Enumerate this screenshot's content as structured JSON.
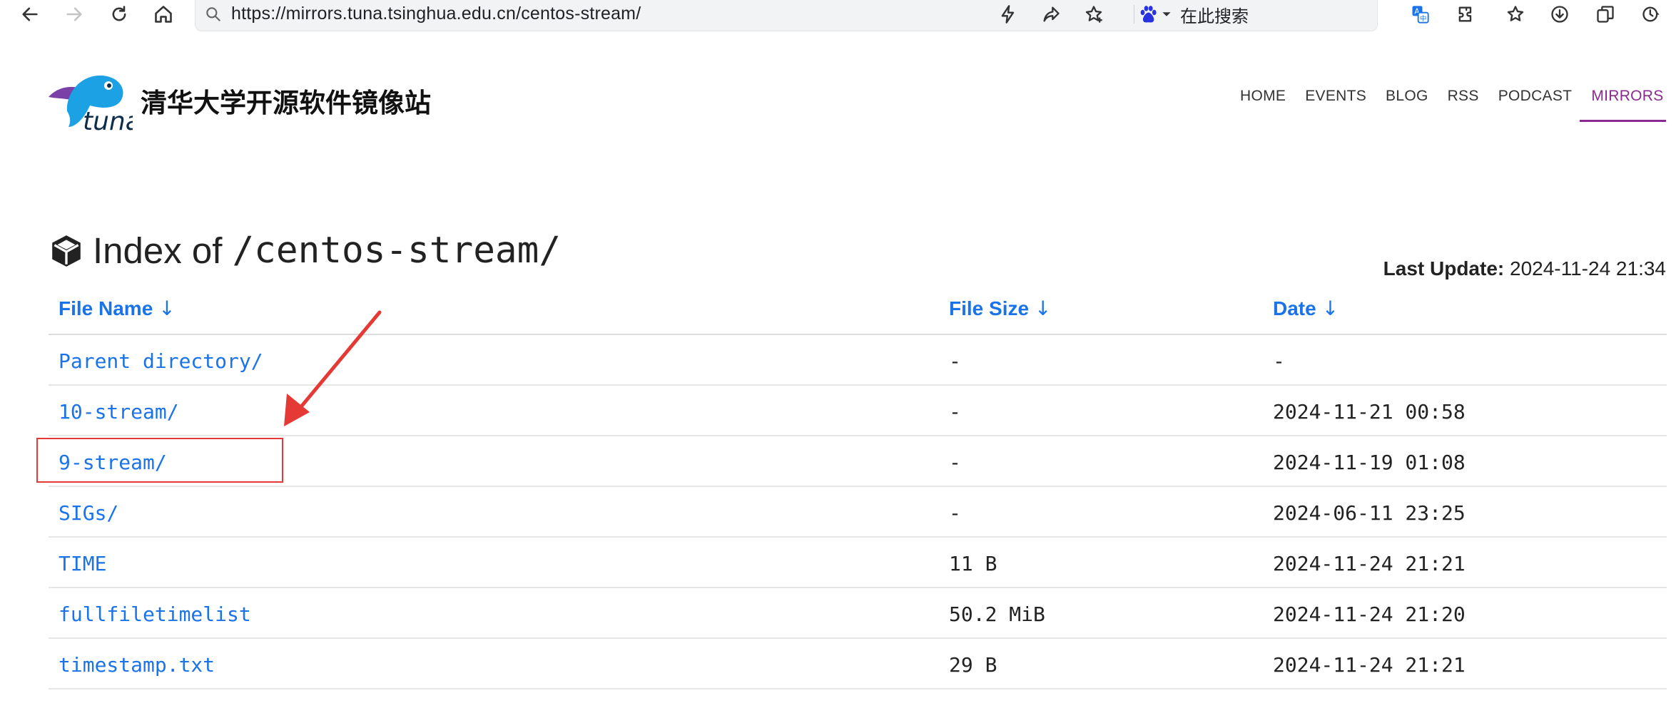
{
  "browser": {
    "url": "https://mirrors.tuna.tsinghua.edu.cn/centos-stream/",
    "search_engine_label": "在此搜索",
    "nav_icons": [
      "back-icon",
      "forward-icon",
      "reload-icon",
      "home-icon"
    ],
    "right_icons": [
      "translate-icon",
      "extensions-icon",
      "bookmarks-icon",
      "downloads-icon",
      "tab-collections-icon",
      "history-icon"
    ]
  },
  "site": {
    "title": "清华大学开源软件镜像站",
    "nav": [
      {
        "label": "HOME"
      },
      {
        "label": "EVENTS"
      },
      {
        "label": "BLOG"
      },
      {
        "label": "RSS"
      },
      {
        "label": "PODCAST"
      },
      {
        "label": "MIRRORS",
        "active": true
      }
    ]
  },
  "page": {
    "heading_prefix": "Index of",
    "heading_path": "/centos-stream/",
    "last_update_label": "Last Update:",
    "last_update_value": "2024-11-24 21:34"
  },
  "table": {
    "columns": [
      {
        "label": "File Name",
        "sort_arrow": "↓"
      },
      {
        "label": "File Size",
        "sort_arrow": "↓"
      },
      {
        "label": "Date",
        "sort_arrow": "↓"
      }
    ],
    "rows": [
      {
        "name": "Parent directory/",
        "size": "-",
        "date": "-"
      },
      {
        "name": "10-stream/",
        "size": "-",
        "date": "2024-11-21 00:58"
      },
      {
        "name": "9-stream/",
        "size": "-",
        "date": "2024-11-19 01:08"
      },
      {
        "name": "SIGs/",
        "size": "-",
        "date": "2024-06-11 23:25"
      },
      {
        "name": "TIME",
        "size": "11 B",
        "date": "2024-11-24 21:21"
      },
      {
        "name": "fullfiletimelist",
        "size": "50.2 MiB",
        "date": "2024-11-24 21:20"
      },
      {
        "name": "timestamp.txt",
        "size": "29 B",
        "date": "2024-11-24 21:21"
      }
    ]
  },
  "colors": {
    "link": "#1a73e8",
    "nav_active": "#8a2a90",
    "annotation": "#e53935"
  }
}
